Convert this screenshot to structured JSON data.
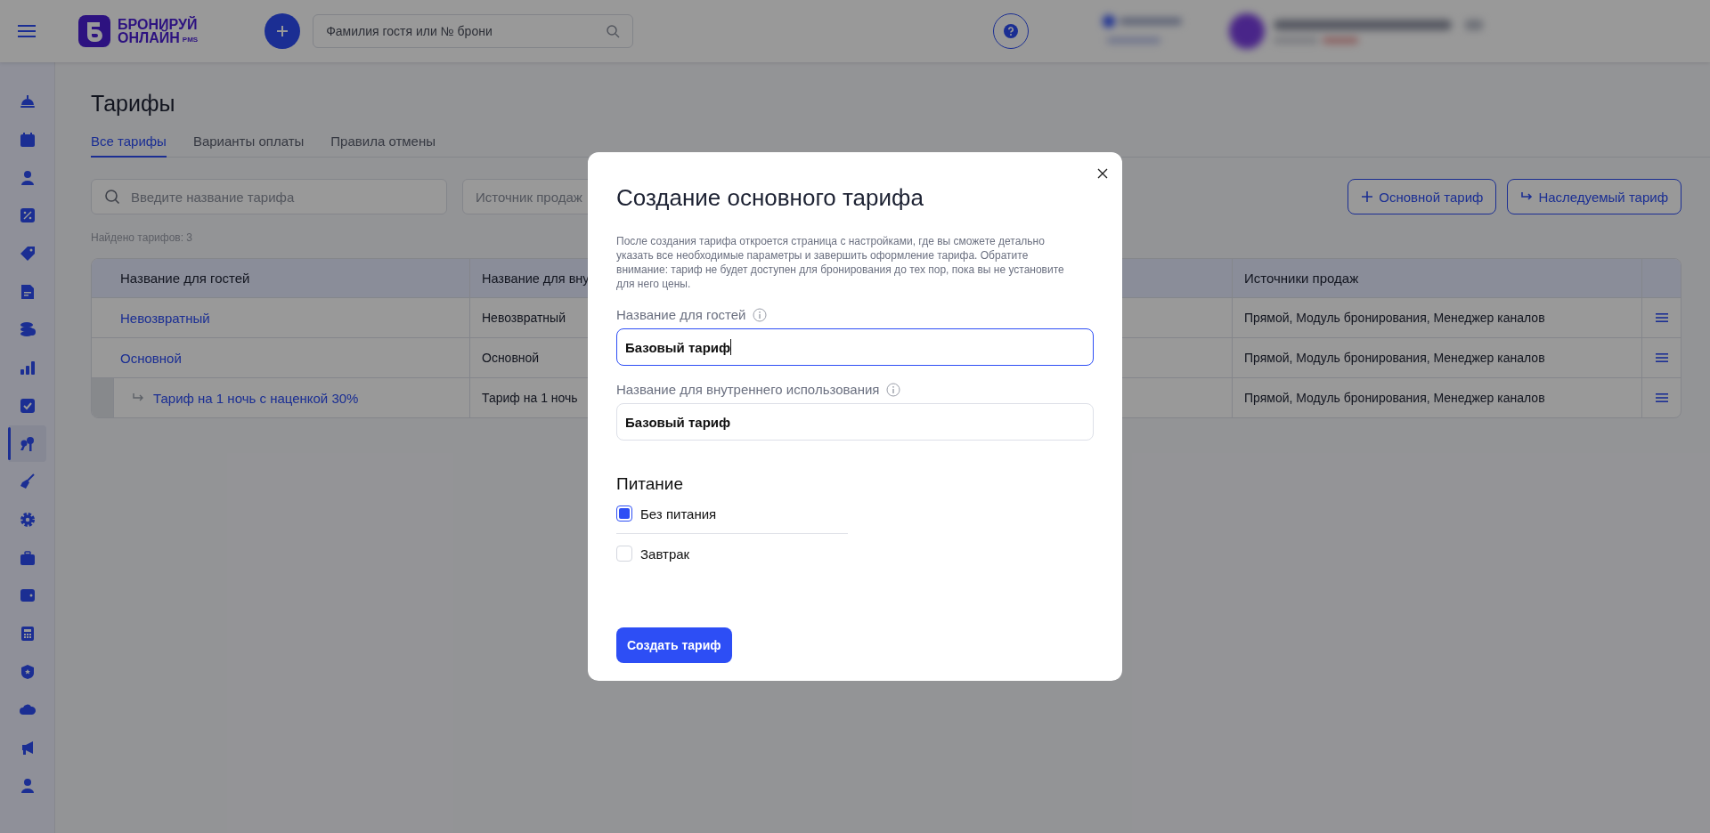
{
  "header": {
    "logo_line1": "БРОНИРУЙ",
    "logo_line2": "ОНЛАЙН",
    "logo_badge": "PMS",
    "search": {
      "placeholder": "Фамилия гостя или № брони"
    }
  },
  "sidebar": {
    "items": [
      {
        "selected": false
      },
      {
        "selected": false
      },
      {
        "selected": false
      },
      {
        "selected": false
      },
      {
        "selected": false
      },
      {
        "selected": false
      },
      {
        "selected": false
      },
      {
        "selected": false
      },
      {
        "selected": false
      },
      {
        "selected": true
      },
      {
        "selected": false
      },
      {
        "selected": false
      },
      {
        "selected": false
      },
      {
        "selected": false
      },
      {
        "selected": false
      },
      {
        "selected": false
      },
      {
        "selected": false
      },
      {
        "selected": false
      },
      {
        "selected": false
      }
    ]
  },
  "page": {
    "title": "Тарифы",
    "tabs": [
      {
        "label": "Все тарифы",
        "selected": true
      },
      {
        "label": "Варианты оплаты",
        "selected": false
      },
      {
        "label": "Правила отмены",
        "selected": false
      }
    ],
    "search": {
      "placeholder": "Введите название тарифа"
    },
    "source_filter": {
      "placeholder": "Источник продаж"
    },
    "buttons": [
      {
        "kind": "add",
        "label": "Основной тариф"
      },
      {
        "kind": "inherit",
        "label": "Наследуемый тариф"
      }
    ],
    "found": "Найдено тарифов: 3"
  },
  "table": {
    "columns": [
      "Название для гостей",
      "Название для вну",
      "Источники продаж"
    ],
    "rows": [
      {
        "guest_name": "Невозвратный",
        "inherited": false,
        "internal_name": "Невозвратный",
        "sources": "Прямой, Модуль бронирования, Менеджер каналов"
      },
      {
        "guest_name": "Основной",
        "inherited": false,
        "internal_name": "Основной",
        "sources": "Прямой, Модуль бронирования, Менеджер каналов"
      },
      {
        "guest_name": "Тариф на 1 ночь с наценкой 30%",
        "inherited": true,
        "internal_name": "Тариф на 1 ночь",
        "sources": "Прямой, Модуль бронирования, Менеджер каналов"
      }
    ]
  },
  "dialog": {
    "title": "Создание основного тарифа",
    "description": "После создания тарифа откроется страница с настройками, где вы сможете детально указать все необходимые параметры и завершить оформление тарифа. Обратите внимание: тариф не будет доступен для бронирования до тех пор, пока вы не установите для него цены.",
    "fields": [
      {
        "label": "Название для гостей",
        "value": "Базовый тариф",
        "focused": true
      },
      {
        "label": "Название для внутреннего использования",
        "value": "Базовый тариф",
        "focused": false
      }
    ],
    "meal": {
      "title": "Питание",
      "options": [
        {
          "label": "Без питания",
          "checked": true
        },
        {
          "label": "Завтрак",
          "checked": false
        }
      ]
    },
    "submit": "Создать тариф"
  }
}
